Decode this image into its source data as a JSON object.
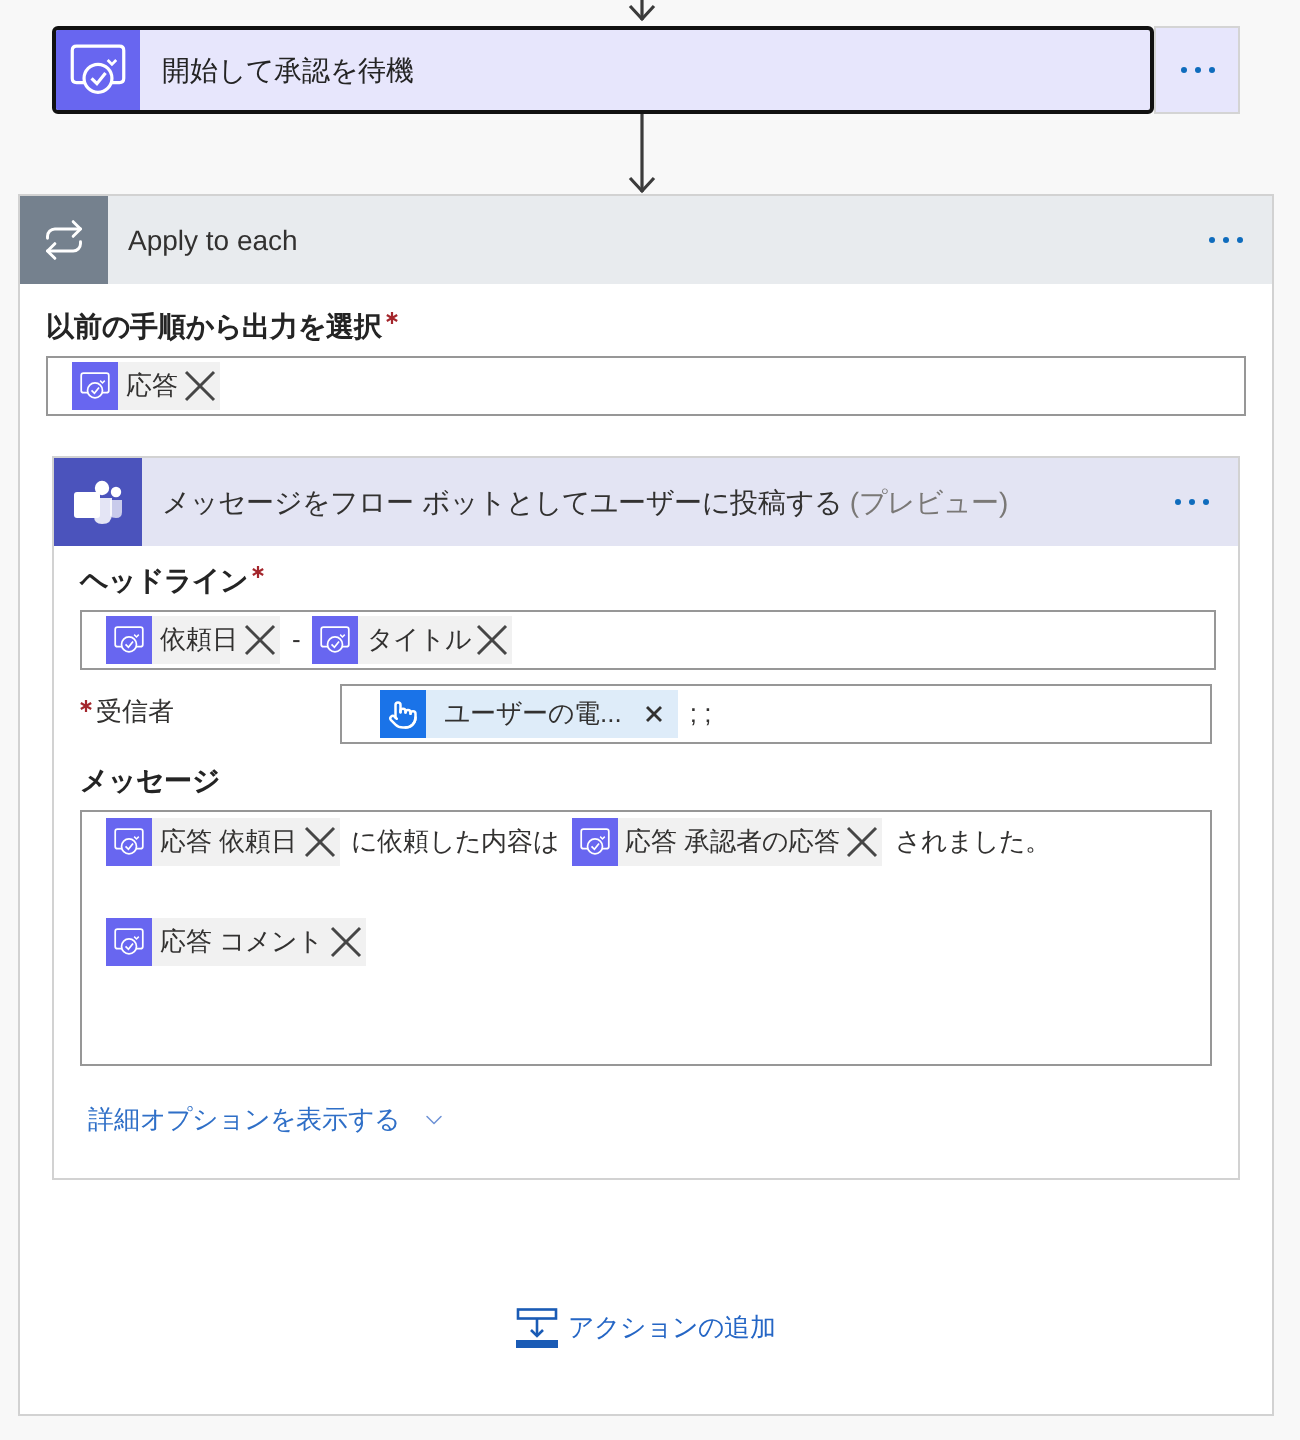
{
  "approval_step": {
    "title": "開始して承認を待機",
    "selected": true
  },
  "loop": {
    "title": "Apply to each",
    "output_field": {
      "kind": "single_line",
      "label": "以前の手順から出力を選択",
      "required": true,
      "lines": [
        [
          {
            "kind": "approval_token",
            "label": "応答"
          }
        ]
      ]
    },
    "action": {
      "title": "メッセージをフロー ボットとしてユーザーに投稿する",
      "title_suffix": "(プレビュー)",
      "fields": [
        {
          "kind": "single_line",
          "label": "ヘッドライン",
          "required": true,
          "lines": [
            [
              {
                "kind": "approval_token",
                "label": "依頼日"
              },
              {
                "kind": "text",
                "text": "-"
              },
              {
                "kind": "approval_token",
                "label": "タイトル"
              }
            ]
          ]
        },
        {
          "kind": "inline",
          "label": "受信者",
          "required": true,
          "lines": [
            [
              {
                "kind": "trigger_token",
                "label": "ユーザーの電..."
              },
              {
                "kind": "text",
                "text": "; ;"
              }
            ]
          ]
        },
        {
          "kind": "multiline",
          "label": "メッセージ",
          "lines": [
            [
              {
                "kind": "approval_token",
                "label": "応答 依頼日"
              },
              {
                "kind": "text",
                "text": "に依頼した内容は"
              },
              {
                "kind": "approval_token",
                "label": "応答 承認者の応答"
              },
              {
                "kind": "text",
                "text": "されました。"
              }
            ],
            [
              {
                "kind": "approval_token",
                "label": "応答 コメント"
              }
            ]
          ]
        }
      ],
      "advanced_link": "詳細オプションを表示する"
    },
    "add_action": "アクションの追加"
  }
}
